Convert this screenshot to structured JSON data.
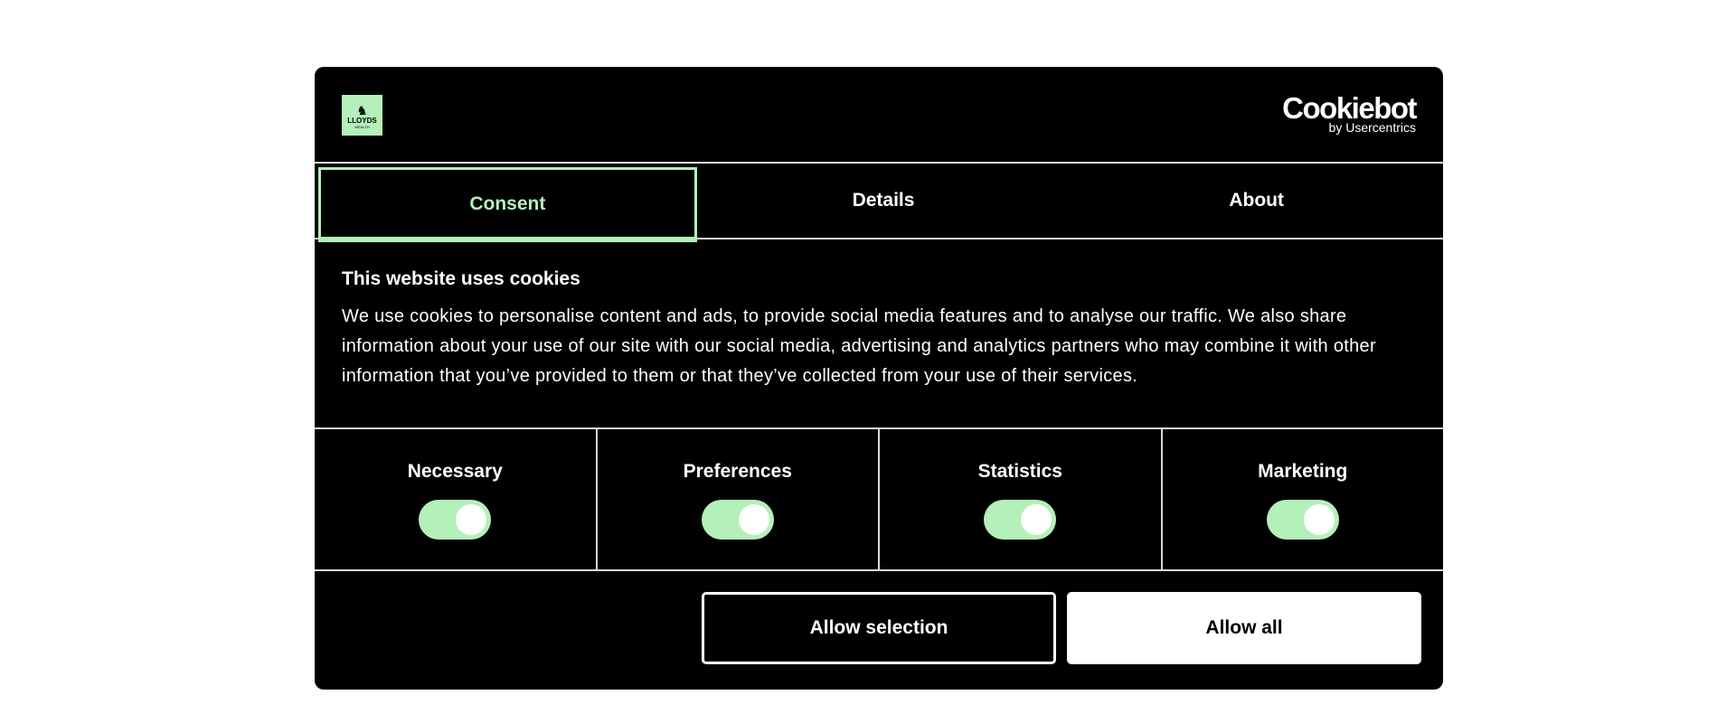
{
  "logo": {
    "brand": "LLOYDS",
    "sub": "WEALTH",
    "icon": "horse-icon"
  },
  "provider": {
    "name": "Cookiebot",
    "sub": "by Usercentrics"
  },
  "tabs": [
    {
      "label": "Consent",
      "active": true
    },
    {
      "label": "Details",
      "active": false
    },
    {
      "label": "About",
      "active": false
    }
  ],
  "content": {
    "heading": "This website uses cookies",
    "text": "We use cookies to personalise content and ads, to provide social media features and to analyse our traffic. We also share information about your use of our site with our social media, advertising and analytics partners who may combine it with other information that you’ve provided to them or that they’ve collected from your use of their services."
  },
  "categories": [
    {
      "label": "Necessary",
      "enabled": true
    },
    {
      "label": "Preferences",
      "enabled": true
    },
    {
      "label": "Statistics",
      "enabled": true
    },
    {
      "label": "Marketing",
      "enabled": true
    }
  ],
  "buttons": {
    "allow_selection": "Allow selection",
    "allow_all": "Allow all"
  },
  "colors": {
    "accent": "#b4f0b9",
    "background": "#000000",
    "divider": "#d9d9d9"
  }
}
